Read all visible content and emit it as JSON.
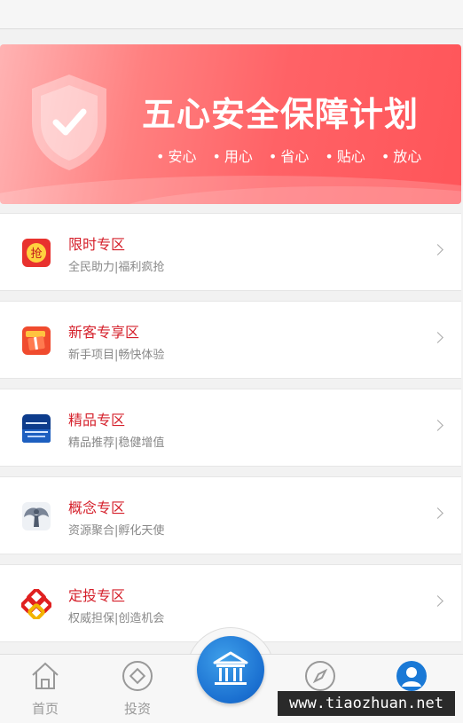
{
  "banner": {
    "title": "五心安全保障计划",
    "tags": [
      "安心",
      "用心",
      "省心",
      "贴心",
      "放心"
    ]
  },
  "sections": [
    {
      "name": "限时专区",
      "desc": "全民助力|福利疯抢",
      "icon": "qiang-icon"
    },
    {
      "name": "新客专享区",
      "desc": "新手项目|畅快体验",
      "icon": "gift-icon"
    },
    {
      "name": "精品专区",
      "desc": "精品推荐|稳健增值",
      "icon": "cooperation-icon"
    },
    {
      "name": "概念专区",
      "desc": "资源聚合|孵化天使",
      "icon": "angel-icon"
    },
    {
      "name": "定投专区",
      "desc": "权威担保|创造机会",
      "icon": "chinese-knot-icon"
    }
  ],
  "tabbar": {
    "home": "首页",
    "invest": "投资"
  },
  "watermark": "www.tiaozhuan.net",
  "colors": {
    "accent": "#d5202b",
    "banner": "#ff5c60",
    "center_button": "#1a6fd0"
  }
}
